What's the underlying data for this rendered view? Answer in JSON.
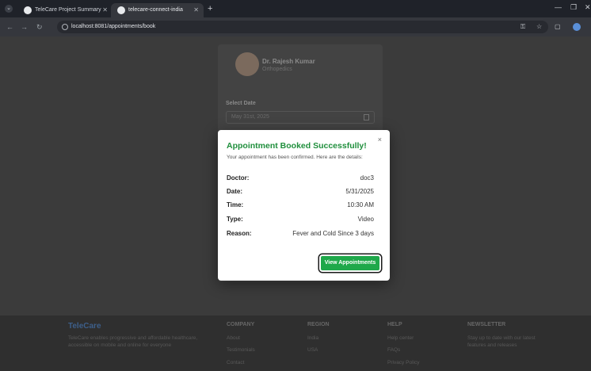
{
  "browser": {
    "tabs": [
      {
        "title": "TeleCare Project Summary"
      },
      {
        "title": "telecare-connect-india"
      }
    ],
    "url": "localhost:8081/appointments/book"
  },
  "page": {
    "doctor": {
      "name": "Dr. Rajesh Kumar",
      "specialty": "Orthopedics"
    },
    "select_date_label": "Select Date",
    "date_value": "May 31st, 2025"
  },
  "footer": {
    "brand": "TeleCare",
    "description": "TeleCare enables progressive and affordable healthcare, accessible on mobile and online for everyone",
    "columns": [
      {
        "heading": "COMPANY",
        "links": [
          "About",
          "Testimonials",
          "Contact"
        ]
      },
      {
        "heading": "REGION",
        "links": [
          "India",
          "USA"
        ]
      },
      {
        "heading": "HELP",
        "links": [
          "Help center",
          "FAQs",
          "Privacy Policy"
        ]
      }
    ],
    "newsletter": {
      "heading": "NEWSLETTER",
      "text": "Stay up to date with our latest features and releases"
    }
  },
  "modal": {
    "title": "Appointment Booked Successfully!",
    "subtitle": "Your appointment has been confirmed. Here are the details:",
    "close_symbol": "×",
    "details": [
      {
        "label": "Doctor:",
        "value": "doc3"
      },
      {
        "label": "Date:",
        "value": "5/31/2025"
      },
      {
        "label": "Time:",
        "value": "10:30 AM"
      },
      {
        "label": "Type:",
        "value": "Video"
      },
      {
        "label": "Reason:",
        "value": "Fever and Cold Since 3 days"
      }
    ],
    "button_label": "View Appointments"
  },
  "colors": {
    "success": "#1f8f3c",
    "button": "#1fa84a",
    "brand": "#3d5f8a"
  }
}
